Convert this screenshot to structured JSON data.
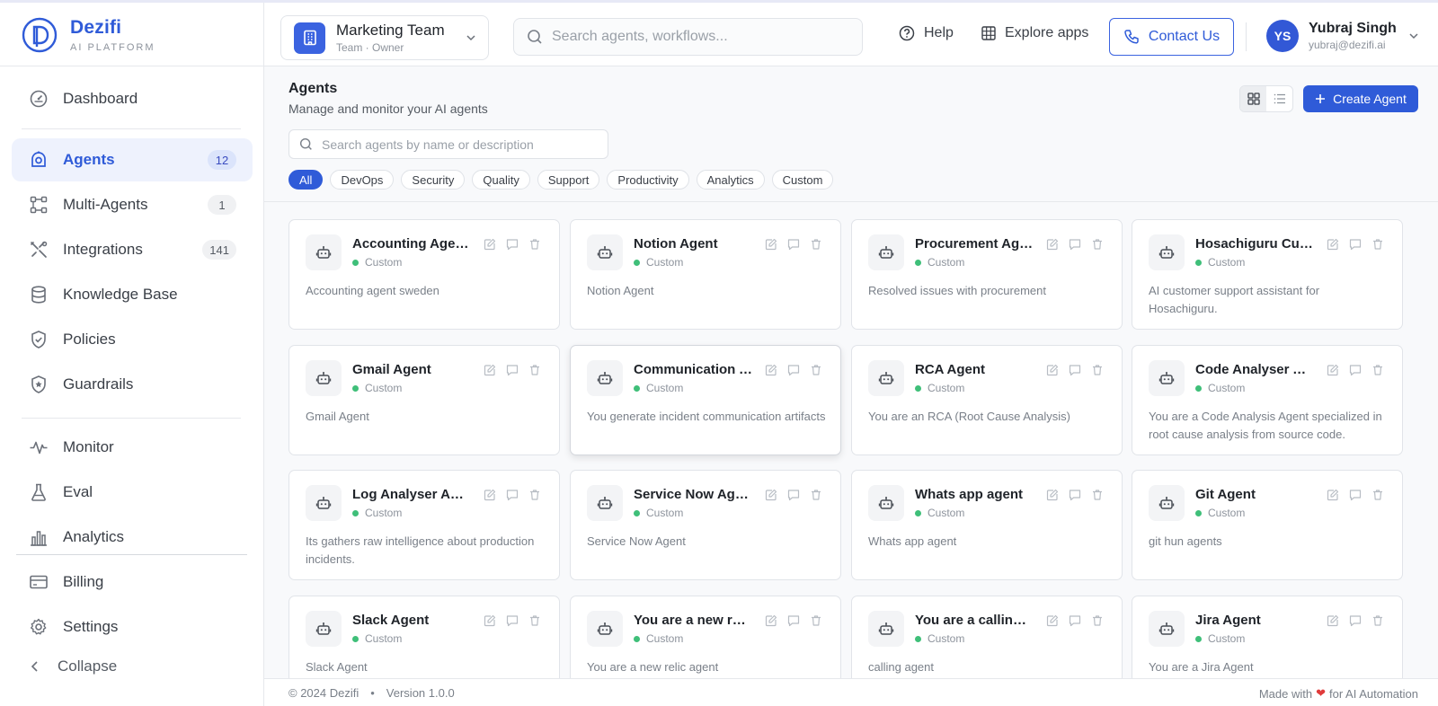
{
  "brand": {
    "name": "Dezifi",
    "tagline": "AI PLATFORM"
  },
  "team": {
    "name": "Marketing Team",
    "role": "Team · Owner"
  },
  "topbar": {
    "search_placeholder": "Search agents, workflows...",
    "help": "Help",
    "explore": "Explore apps",
    "contact": "Contact Us"
  },
  "user": {
    "initials": "YS",
    "name": "Yubraj Singh",
    "email": "yubraj@dezifi.ai"
  },
  "sidebar": {
    "items": [
      {
        "label": "Dashboard",
        "icon": "gauge-icon"
      },
      {
        "label": "Agents",
        "icon": "agent-icon",
        "badge": "12",
        "active": true
      },
      {
        "label": "Multi-Agents",
        "icon": "workflow-icon",
        "badge": "1"
      },
      {
        "label": "Integrations",
        "icon": "tools-icon",
        "badge": "141"
      },
      {
        "label": "Knowledge Base",
        "icon": "database-icon"
      },
      {
        "label": "Policies",
        "icon": "shield-check-icon"
      },
      {
        "label": "Guardrails",
        "icon": "shield-star-icon"
      },
      {
        "label": "Monitor",
        "icon": "activity-icon"
      },
      {
        "label": "Eval",
        "icon": "flask-icon"
      },
      {
        "label": "Analytics",
        "icon": "bar-chart-icon"
      },
      {
        "label": "Billing",
        "icon": "card-icon"
      },
      {
        "label": "Settings",
        "icon": "gear-icon"
      }
    ],
    "collapse": "Collapse"
  },
  "page": {
    "title": "Agents",
    "subtitle": "Manage and monitor your AI agents",
    "create_label": "Create Agent",
    "search_placeholder": "Search agents by name or description",
    "filters": [
      "All",
      "DevOps",
      "Security",
      "Quality",
      "Support",
      "Productivity",
      "Analytics",
      "Custom"
    ],
    "active_filter": "All"
  },
  "agents": [
    {
      "name": "Accounting Agent sweden",
      "tag": "Custom",
      "desc": "Accounting agent sweden"
    },
    {
      "name": "Notion Agent",
      "tag": "Custom",
      "desc": "Notion Agent"
    },
    {
      "name": "Procurement Agent",
      "tag": "Custom",
      "desc": "Resolved issues with procurement"
    },
    {
      "name": "Hosachiguru Customer Support",
      "tag": "Custom",
      "desc": "AI customer support assistant for Hosachiguru."
    },
    {
      "name": "Gmail Agent",
      "tag": "Custom",
      "desc": "Gmail Agent"
    },
    {
      "name": "Communication Agent",
      "tag": "Custom",
      "desc": "You generate incident communication artifacts"
    },
    {
      "name": "RCA Agent",
      "tag": "Custom",
      "desc": "You are an RCA (Root Cause Analysis)"
    },
    {
      "name": "Code Analyser Agent",
      "tag": "Custom",
      "desc": "You are a Code Analysis Agent specialized in root cause analysis from source code."
    },
    {
      "name": "Log Analyser Agent",
      "tag": "Custom",
      "desc": "Its gathers raw intelligence about production incidents."
    },
    {
      "name": "Service Now Agent",
      "tag": "Custom",
      "desc": "Service Now Agent"
    },
    {
      "name": "Whats app agent",
      "tag": "Custom",
      "desc": "Whats app agent"
    },
    {
      "name": "Git Agent",
      "tag": "Custom",
      "desc": "git hun agents"
    },
    {
      "name": "Slack Agent",
      "tag": "Custom",
      "desc": "Slack Agent"
    },
    {
      "name": "You are a new relic agent",
      "tag": "Custom",
      "desc": "You are a new relic agent"
    },
    {
      "name": "You are a calling agent",
      "tag": "Custom",
      "desc": "calling agent"
    },
    {
      "name": "Jira Agent",
      "tag": "Custom",
      "desc": "You are a Jira Agent"
    }
  ],
  "footer": {
    "copyright": "© 2024 Dezifi",
    "bullet": "•",
    "version": "Version 1.0.0",
    "made_with": "Made with",
    "heart": "❤",
    "made_for": "for AI Automation"
  },
  "colors": {
    "accent": "#2f5bd8",
    "status_dot": "#3fbf79",
    "heart": "#e03b3b"
  }
}
